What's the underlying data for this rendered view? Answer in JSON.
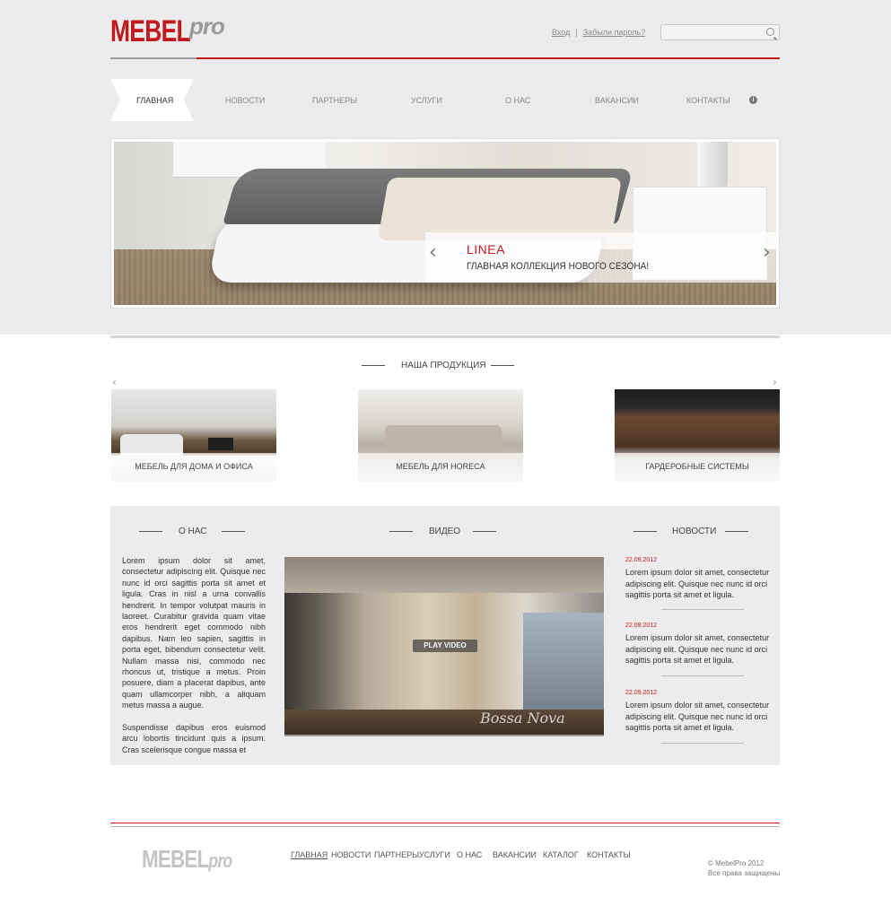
{
  "header": {
    "logo_main": "MEBEL",
    "logo_suffix": "pro",
    "login_link": "Вход",
    "separator": "|",
    "forgot_link": "Забыли пароль?",
    "search_placeholder": ""
  },
  "nav": {
    "items": [
      "ГЛАВНАЯ",
      "НОВОСТИ",
      "ПАРТНЕРЫ",
      "УСЛУГИ",
      "О НАС",
      "ВАКАНСИИ",
      "КОНТАКТЫ"
    ],
    "active": "ГЛАВНАЯ"
  },
  "slider": {
    "title": "LINEA",
    "subtitle": "ГЛАВНАЯ КОЛЛЕКЦИЯ НОВОГО СЕЗОНА!",
    "prev_icon": "‹",
    "next_icon": "›"
  },
  "products": {
    "title": "НАША ПРОДУКЦИЯ",
    "items": [
      "МЕБЕЛЬ ДЛЯ ДОМА И ОФИСА",
      "МЕБЕЛЬ ДЛЯ HORECA",
      "ГАРДЕРОБНЫЕ СИСТЕМЫ"
    ],
    "prev_icon": "‹",
    "next_icon": "›"
  },
  "about": {
    "title": "О НАС",
    "paragraphs": [
      "Lorem ipsum dolor sit amet, consectetur adipiscing elit. Quisque nec nunc id orci sagittis porta sit amet et ligula. Cras in nisl a urna convallis hendrerit. In tempor volutpat mauris in laoreet. Curabitur gravida quam vitae eros hendrerit eget commodo nibh dapibus. Nam leo sapien, sagittis in porta eget, bibendum consectetur velit. Nullam massa nisi, commodo nec rhoncus ut, tristique a metus. Proin posuere, diam a placerat dapibus, ante quam ullamcorper nibh, a aliquam metus massa a augue.",
      "Suspendisse dapibus eros euismod arcu lobortis tincidunt quis a ipsum. Cras scelerisque congue massa et"
    ]
  },
  "video": {
    "title": "ВИДЕО",
    "play_label": "PLAY VIDEO",
    "watermark": "Bossa Nova"
  },
  "news": {
    "title": "НОВОСТИ",
    "items": [
      {
        "date": "22.09.2012",
        "text": "Lorem ipsum dolor sit amet, consectetur adipiscing elit. Quisque nec nunc id orci sagittis porta sit amet et ligula."
      },
      {
        "date": "22.09.2012",
        "text": "Lorem ipsum dolor sit amet, consectetur adipiscing elit. Quisque nec nunc id orci sagittis porta sit amet et ligula."
      },
      {
        "date": "22.09.2012",
        "text": "Lorem ipsum dolor sit amet, consectetur adipiscing elit. Quisque nec nunc id orci sagittis porta sit amet et ligula."
      }
    ]
  },
  "footer": {
    "logo_main": "MEBEL",
    "logo_suffix": "pro",
    "nav": [
      "ГЛАВНАЯ",
      "НОВОСТИ",
      "ПАРТНЕРЫ",
      "УСЛУГИ",
      "О НАС",
      "ВАКАНСИИ",
      "КАТАЛОГ",
      "КОНТАКТЫ"
    ],
    "copyright_line1": "© MebelPro 2012",
    "copyright_line2": "Все права защищены"
  },
  "colors": {
    "accent": "#c1191e",
    "top_background": "#ebebeb",
    "panel_background": "#ececec"
  },
  "icons": {
    "search": "search-icon",
    "info": "info-icon"
  }
}
